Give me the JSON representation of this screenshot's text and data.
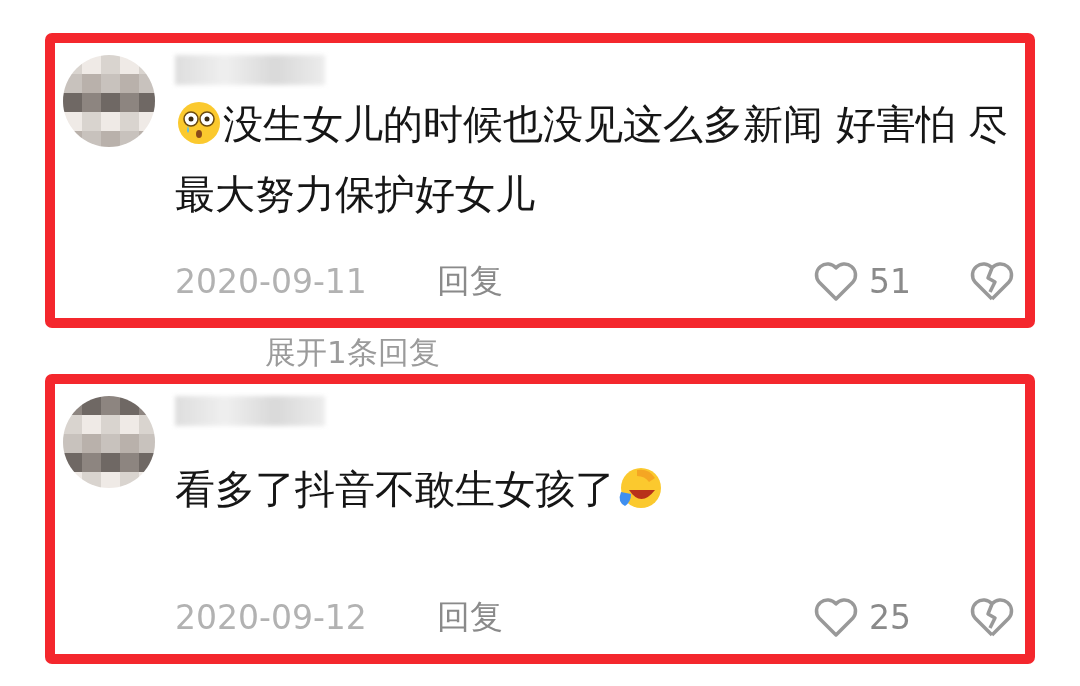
{
  "comments": [
    {
      "parts": [
        {
          "kind": "shocked_emoji"
        },
        {
          "kind": "text",
          "text": "没生女儿的时候也没见这么多新闻 好害怕 尽最大努力保护好女儿"
        }
      ],
      "date": "2020-09-11",
      "reply": "回复",
      "likes": "51",
      "highlighted": true,
      "more_replies": "展开1条回复"
    },
    {
      "parts": [
        {
          "kind": "text",
          "text": "看多了抖音不敢生女孩了"
        },
        {
          "kind": "laughing_emoji"
        }
      ],
      "date": "2020-09-12",
      "reply": "回复",
      "likes": "25",
      "highlighted": true
    }
  ]
}
